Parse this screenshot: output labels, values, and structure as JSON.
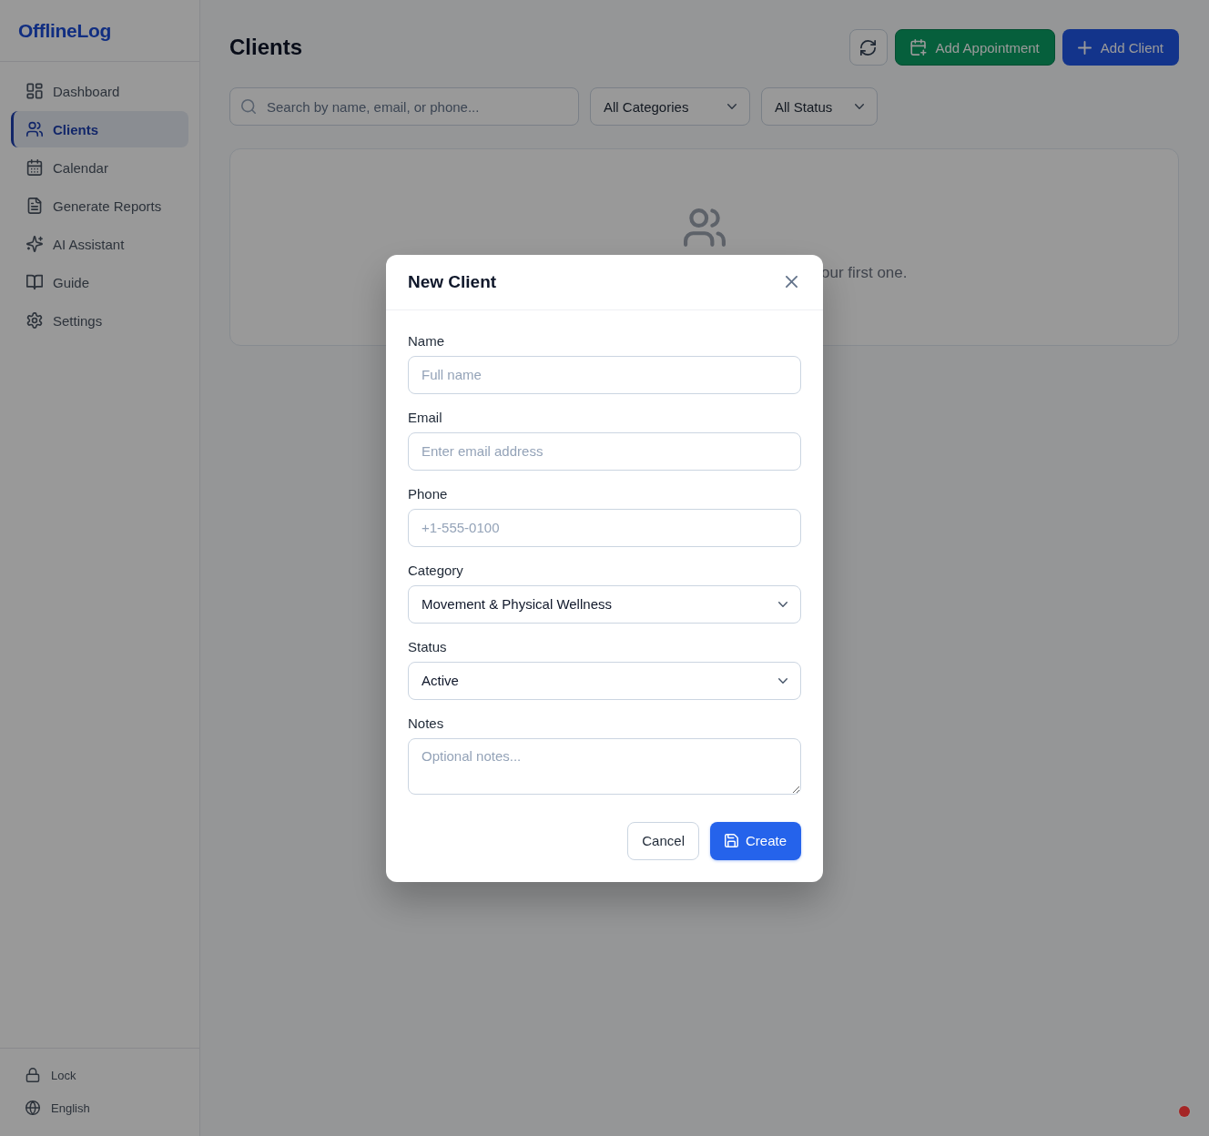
{
  "sidebar": {
    "logo": "OfflineLog",
    "nav": [
      {
        "label": "Dashboard",
        "selected": false
      },
      {
        "label": "Clients",
        "selected": true
      },
      {
        "label": "Calendar",
        "selected": false
      },
      {
        "label": "Generate Reports",
        "selected": false
      },
      {
        "label": "AI Assistant",
        "selected": false
      },
      {
        "label": "Guide",
        "selected": false
      },
      {
        "label": "Settings",
        "selected": false
      }
    ],
    "footer": [
      {
        "label": "Lock"
      },
      {
        "label": "English"
      }
    ]
  },
  "header": {
    "title": "Clients",
    "buttons": [
      {
        "kind": "appointment",
        "label": "Add Appointment"
      },
      {
        "kind": "add",
        "label": "Add Client"
      }
    ]
  },
  "filters": {
    "search": {
      "placeholder": "Search by name, email, or phone..."
    },
    "selects": [
      {
        "value": "All Categories"
      },
      {
        "value": "All Status"
      }
    ]
  },
  "empty_state": {
    "message": "our first one."
  },
  "dialog": {
    "title": "New Client",
    "fields": [
      {
        "kind": "text",
        "label": "Name",
        "placeholder": "Full name"
      },
      {
        "kind": "text",
        "label": "Email",
        "placeholder": "Enter email address"
      },
      {
        "kind": "text",
        "label": "Phone",
        "placeholder": "+1-555-0100"
      },
      {
        "kind": "select",
        "label": "Category",
        "value": "Movement & Physical Wellness"
      },
      {
        "kind": "select",
        "label": "Status",
        "value": "Active"
      },
      {
        "kind": "textarea",
        "label": "Notes",
        "placeholder": "Optional notes..."
      }
    ],
    "buttons": [
      {
        "kind": "secondary",
        "label": "Cancel"
      },
      {
        "kind": "primary",
        "label": "Create"
      }
    ]
  }
}
